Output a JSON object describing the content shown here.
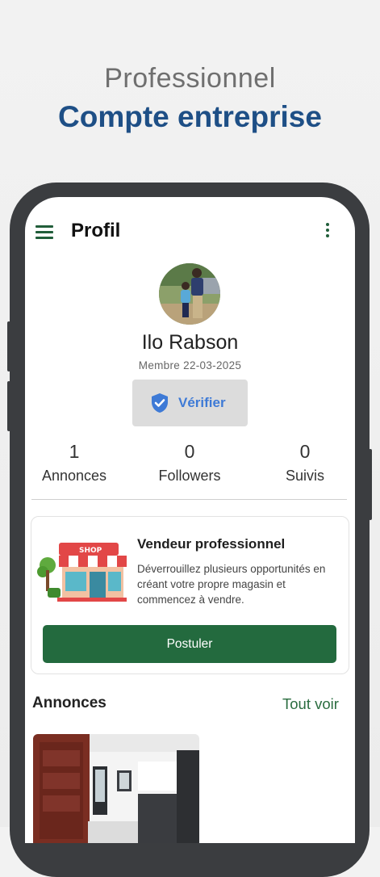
{
  "hero": {
    "subtitle": "Professionnel",
    "title": "Compte entreprise"
  },
  "appbar": {
    "title": "Profil",
    "menu_icon": "hamburger-menu-icon",
    "more_icon": "more-vertical-icon"
  },
  "profile": {
    "name": "Ilo Rabson",
    "member_since": "Membre  22-03-2025",
    "verify_label": "Vérifier",
    "verify_icon": "shield-check-icon"
  },
  "stats": [
    {
      "value": "1",
      "label": "Annonces"
    },
    {
      "value": "0",
      "label": "Followers"
    },
    {
      "value": "0",
      "label": "Suivis"
    }
  ],
  "promo": {
    "title": "Vendeur professionnel",
    "text": "Déverrouillez plusieurs opportunités en créant votre propre magasin et commencez à vendre.",
    "button_label": "Postuler",
    "shop_sign": "SHOP"
  },
  "listings": {
    "section_title": "Annonces",
    "see_all": "Tout voir"
  },
  "colors": {
    "brand_green": "#236a3e",
    "hero_blue": "#1e4f86",
    "verify_blue": "#3e7ad6",
    "phone_frame": "#3b3d40"
  }
}
